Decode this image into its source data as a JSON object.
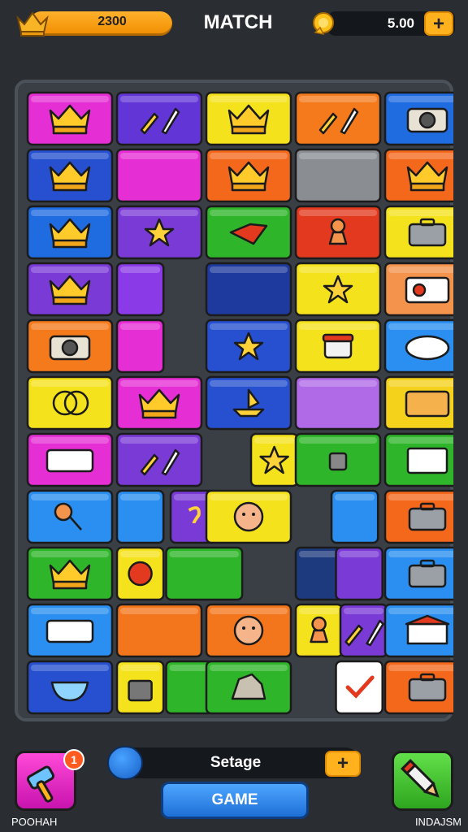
{
  "header": {
    "score_value": "2300",
    "title": "MATCH",
    "coins_value": "5.00",
    "coins_plus": "+",
    "crown_icon": "crown-icon",
    "coin_icon": "coin-icon"
  },
  "board": {
    "tiles": [
      {
        "row": 0,
        "cols": [
          0
        ],
        "color": "#e52ed4",
        "icon": "crown"
      },
      {
        "row": 0,
        "cols": [
          1
        ],
        "color": "#6236d6",
        "icon": "tools"
      },
      {
        "row": 0,
        "cols": [
          2
        ],
        "color": "#f4e21c",
        "icon": "crown"
      },
      {
        "row": 0,
        "cols": [
          3
        ],
        "color": "#f47a1c",
        "icon": "tools"
      },
      {
        "row": 0,
        "cols": [
          4
        ],
        "color": "#1f6be0",
        "icon": "camera"
      },
      {
        "row": 1,
        "cols": [
          0
        ],
        "color": "#2650cf",
        "icon": "crown"
      },
      {
        "row": 1,
        "cols": [
          1
        ],
        "color": "#e52ed4",
        "icon": ""
      },
      {
        "row": 1,
        "cols": [
          2
        ],
        "color": "#f4681c",
        "icon": "crown"
      },
      {
        "row": 1,
        "cols": [
          3
        ],
        "color": "#8a8d92",
        "icon": ""
      },
      {
        "row": 1,
        "cols": [
          4
        ],
        "color": "#f4681c",
        "icon": "crown"
      },
      {
        "row": 2,
        "cols": [
          0
        ],
        "color": "#1f6be0",
        "icon": "crown"
      },
      {
        "row": 2,
        "cols": [
          1
        ],
        "color": "#7a3ad6",
        "icon": "star"
      },
      {
        "row": 2,
        "cols": [
          2
        ],
        "color": "#2fb52a",
        "icon": "flag"
      },
      {
        "row": 2,
        "cols": [
          3
        ],
        "color": "#e33a1f",
        "icon": "figure"
      },
      {
        "row": 2,
        "cols": [
          4
        ],
        "color": "#f4e21c",
        "icon": "case"
      },
      {
        "row": 3,
        "cols": [
          0
        ],
        "color": "#7a3ad6",
        "icon": "crown"
      },
      {
        "row": 3,
        "cols": [
          1
        ],
        "color": "#8a3ae6",
        "icon": "",
        "half": true
      },
      {
        "row": 3,
        "cols": [
          2
        ],
        "color": "#1e3a9e",
        "icon": ""
      },
      {
        "row": 3,
        "cols": [
          3
        ],
        "color": "#f4e21c",
        "icon": "star"
      },
      {
        "row": 3,
        "cols": [
          4
        ],
        "color": "#f4934c",
        "icon": "radio"
      },
      {
        "row": 4,
        "cols": [
          0
        ],
        "color": "#f47a1c",
        "icon": "camera"
      },
      {
        "row": 4,
        "cols": [
          1
        ],
        "color": "#e52ed4",
        "icon": "",
        "half": true
      },
      {
        "row": 4,
        "cols": [
          2
        ],
        "color": "#2650cf",
        "icon": "star"
      },
      {
        "row": 4,
        "cols": [
          3
        ],
        "color": "#f4e21c",
        "icon": "bread"
      },
      {
        "row": 4,
        "cols": [
          4
        ],
        "color": "#2a8ff0",
        "icon": "cloud"
      },
      {
        "row": 5,
        "cols": [
          0
        ],
        "color": "#f4e21c",
        "icon": "ring"
      },
      {
        "row": 5,
        "cols": [
          1
        ],
        "color": "#e52ed4",
        "icon": "crown"
      },
      {
        "row": 5,
        "cols": [
          2
        ],
        "color": "#2650cf",
        "icon": "boat"
      },
      {
        "row": 5,
        "cols": [
          3
        ],
        "color": "#b06ae8",
        "icon": ""
      },
      {
        "row": 5,
        "cols": [
          4
        ],
        "color": "#f4d21c",
        "icon": "card"
      },
      {
        "row": 6,
        "cols": [
          0
        ],
        "color": "#e52ed4",
        "icon": "ticket"
      },
      {
        "row": 6,
        "cols": [
          1
        ],
        "color": "#7a3ad6",
        "icon": "tools"
      },
      {
        "row": 6,
        "cols": [
          2
        ],
        "color": "#f4e21c",
        "icon": "star",
        "half": true,
        "offset": 0.5
      },
      {
        "row": 6,
        "cols": [
          3
        ],
        "color": "#2fb52a",
        "icon": "kettle"
      },
      {
        "row": 6,
        "cols": [
          4
        ],
        "color": "#2fb52a",
        "icon": "doc"
      },
      {
        "row": 7,
        "cols": [
          0
        ],
        "color": "#2a8ff0",
        "icon": "key"
      },
      {
        "row": 7,
        "cols": [
          1
        ],
        "color": "#2a8ff0",
        "icon": "",
        "half": true
      },
      {
        "row": 7,
        "cols": [
          1
        ],
        "color": "#7a3ad6",
        "icon": "hook",
        "half": true,
        "offset": 0.6
      },
      {
        "row": 7,
        "cols": [
          2
        ],
        "color": "#f4e21c",
        "icon": "face"
      },
      {
        "row": 7,
        "cols": [
          3
        ],
        "color": "#2a8ff0",
        "icon": "",
        "half": true,
        "offset": 0.4
      },
      {
        "row": 7,
        "cols": [
          4
        ],
        "color": "#f4681c",
        "icon": "case"
      },
      {
        "row": 8,
        "cols": [
          0
        ],
        "color": "#2fb52a",
        "icon": "crown"
      },
      {
        "row": 8,
        "cols": [
          1
        ],
        "color": "#f4e21c",
        "icon": "ball",
        "half": true
      },
      {
        "row": 8,
        "cols": [
          1
        ],
        "color": "#2fb52a",
        "icon": "",
        "wide": true,
        "offset": 0.55
      },
      {
        "row": 8,
        "cols": [
          3
        ],
        "color": "#1e3a7e",
        "icon": "",
        "half": true
      },
      {
        "row": 8,
        "cols": [
          3
        ],
        "color": "#7a3ad6",
        "icon": "",
        "half": true,
        "offset": 0.45
      },
      {
        "row": 8,
        "cols": [
          4
        ],
        "color": "#2a8ff0",
        "icon": "case"
      },
      {
        "row": 9,
        "cols": [
          0
        ],
        "color": "#2a8ff0",
        "icon": "ticket"
      },
      {
        "row": 9,
        "cols": [
          1
        ],
        "color": "#f4761c",
        "icon": ""
      },
      {
        "row": 9,
        "cols": [
          2
        ],
        "color": "#f4761c",
        "icon": "face"
      },
      {
        "row": 9,
        "cols": [
          3
        ],
        "color": "#f4e21c",
        "icon": "figure",
        "half": true
      },
      {
        "row": 9,
        "cols": [
          3
        ],
        "color": "#7a3ad6",
        "icon": "tools",
        "half": true,
        "offset": 0.5
      },
      {
        "row": 9,
        "cols": [
          4
        ],
        "color": "#2a8ff0",
        "icon": "bank"
      },
      {
        "row": 10,
        "cols": [
          0
        ],
        "color": "#2650cf",
        "icon": "bowl"
      },
      {
        "row": 10,
        "cols": [
          1
        ],
        "color": "#f4e21c",
        "icon": "bag",
        "half": true
      },
      {
        "row": 10,
        "cols": [
          1
        ],
        "color": "#2fb52a",
        "icon": "",
        "half": true,
        "offset": 0.55
      },
      {
        "row": 10,
        "cols": [
          2
        ],
        "color": "#2fb52a",
        "icon": "rock"
      },
      {
        "row": 10,
        "cols": [
          3
        ],
        "color": "#ffffff",
        "icon": "check",
        "half": true,
        "offset": 0.45
      },
      {
        "row": 10,
        "cols": [
          4
        ],
        "color": "#f4681c",
        "icon": "case"
      }
    ]
  },
  "footer": {
    "left_label": "POOHAH",
    "left_badge": "1",
    "left_icon": "hammer-icon",
    "middle_text": "Setage",
    "middle_plus": "+",
    "game_button": "GAME",
    "right_label": "INDAJSM",
    "right_icon": "pencil-icon"
  }
}
